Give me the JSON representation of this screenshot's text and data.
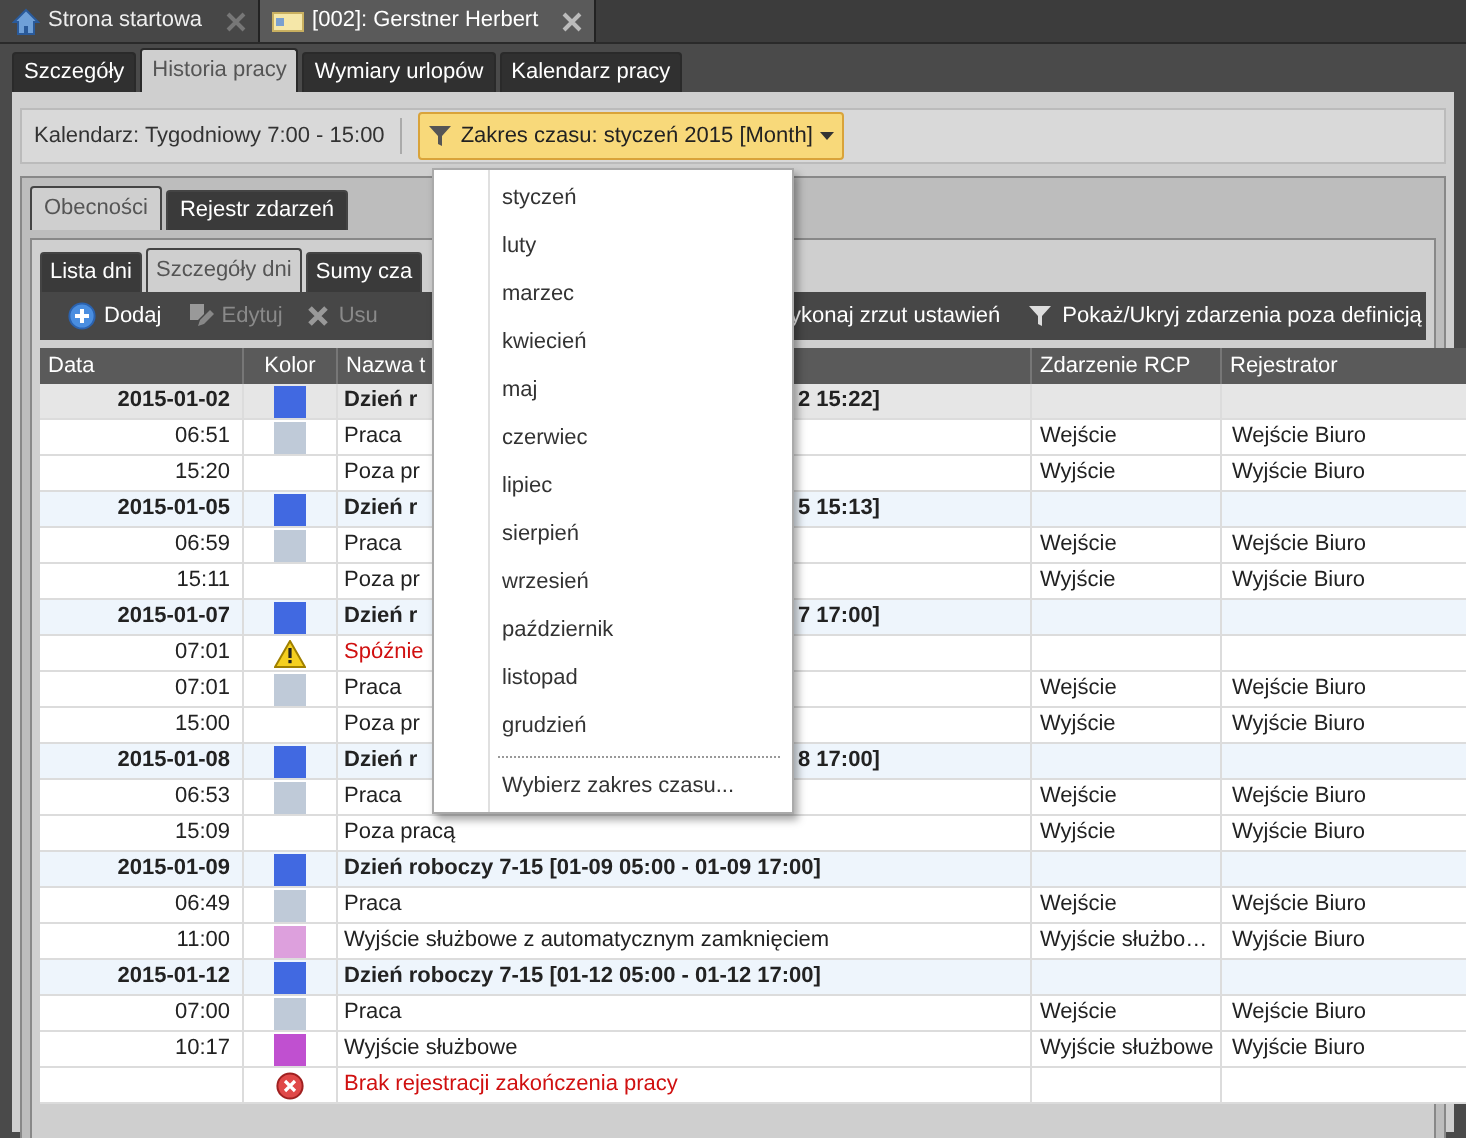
{
  "doc_tabs": [
    {
      "label": "Strona startowa",
      "selected": false
    },
    {
      "label": "[002]: Gerstner Herbert",
      "selected": true
    }
  ],
  "tabs": [
    {
      "label": "Szczegóły",
      "selected": false
    },
    {
      "label": "Historia pracy",
      "selected": true
    },
    {
      "label": "Wymiary urlopów",
      "selected": false
    },
    {
      "label": "Kalendarz pracy",
      "selected": false
    }
  ],
  "calendar_label": "Kalendarz: Tygodniowy 7:00 - 15:00",
  "time_range_button": "Zakres czasu: styczeń 2015 [Month]",
  "inner_tabs": [
    {
      "label": "Obecności",
      "selected": true
    },
    {
      "label": "Rejestr zdarzeń",
      "selected": false
    }
  ],
  "sub_tabs": [
    {
      "label": "Lista dni",
      "selected": false
    },
    {
      "label": "Szczegóły dni",
      "selected": true
    },
    {
      "label": "Sumy cza",
      "selected": false
    }
  ],
  "toolbar": [
    {
      "label": "Dodaj",
      "disabled": false
    },
    {
      "label": "Edytuj",
      "disabled": true
    },
    {
      "label": "Usu",
      "disabled": true
    }
  ],
  "toolbar_right": [
    "ykonaj zrzut ustawień",
    "Pokaż/Ukryj zdarzenia poza definicją"
  ],
  "table": {
    "columns": [
      "Data",
      "Kolor",
      "Nazwa t",
      "Zdarzenie RCP",
      "Rejestrator"
    ],
    "rows": [
      {
        "kind": "day",
        "selected": true,
        "date": "2015-01-02",
        "color": "#4169e1",
        "name": "Dzień r",
        "name_tail": "2 15:22]"
      },
      {
        "kind": "entry",
        "date": "06:51",
        "color": "#bfcad8",
        "name": "Praca",
        "event": "Wejście",
        "registrar": "Wejście Biuro"
      },
      {
        "kind": "entry",
        "date": "15:20",
        "name": "Poza pr",
        "event": "Wyjście",
        "registrar": "Wyjście Biuro"
      },
      {
        "kind": "day",
        "selected": false,
        "date": "2015-01-05",
        "color": "#4169e1",
        "name": "Dzień r",
        "name_tail": "5 15:13]"
      },
      {
        "kind": "entry",
        "date": "06:59",
        "color": "#bfcad8",
        "name": "Praca",
        "event": "Wejście",
        "registrar": "Wejście Biuro"
      },
      {
        "kind": "entry",
        "date": "15:11",
        "name": "Poza pr",
        "event": "Wyjście",
        "registrar": "Wyjście Biuro"
      },
      {
        "kind": "day",
        "selected": false,
        "date": "2015-01-07",
        "color": "#4169e1",
        "name": "Dzień r",
        "name_tail": "7 17:00]"
      },
      {
        "kind": "warning",
        "date": "07:01",
        "name": "Spóźnie"
      },
      {
        "kind": "entry",
        "date": "07:01",
        "color": "#bfcad8",
        "name": "Praca",
        "event": "Wejście",
        "registrar": "Wejście Biuro"
      },
      {
        "kind": "entry",
        "date": "15:00",
        "name": "Poza pr",
        "event": "Wyjście",
        "registrar": "Wyjście Biuro"
      },
      {
        "kind": "day",
        "selected": false,
        "date": "2015-01-08",
        "color": "#4169e1",
        "name": "Dzień r",
        "name_tail": "8 17:00]"
      },
      {
        "kind": "entry",
        "date": "06:53",
        "color": "#bfcad8",
        "name": "Praca",
        "event": "Wejście",
        "registrar": "Wejście Biuro"
      },
      {
        "kind": "entry",
        "date": "15:09",
        "name": "Poza pracą",
        "event": "Wyjście",
        "registrar": "Wyjście Biuro"
      },
      {
        "kind": "day",
        "selected": false,
        "date": "2015-01-09",
        "color": "#4169e1",
        "name": "Dzień roboczy 7-15 [01-09 05:00 - 01-09 17:00]"
      },
      {
        "kind": "entry",
        "date": "06:49",
        "color": "#bfcad8",
        "name": "Praca",
        "event": "Wejście",
        "registrar": "Wejście Biuro"
      },
      {
        "kind": "entry",
        "date": "11:00",
        "color": "#dda0dd",
        "name": "Wyjście służbowe z automatycznym zamknięciem",
        "event": "Wyjście służbo…",
        "registrar": "Wyjście Biuro"
      },
      {
        "kind": "day",
        "selected": false,
        "date": "2015-01-12",
        "color": "#4169e1",
        "name": "Dzień roboczy 7-15 [01-12 05:00 - 01-12 17:00]"
      },
      {
        "kind": "entry",
        "date": "07:00",
        "color": "#bfcad8",
        "name": "Praca",
        "event": "Wejście",
        "registrar": "Wejście Biuro"
      },
      {
        "kind": "entry",
        "date": "10:17",
        "color": "#c050d0",
        "name": "Wyjście służbowe",
        "event": "Wyjście służbowe",
        "registrar": "Wyjście Biuro"
      },
      {
        "kind": "error",
        "name": "Brak rejestracji zakończenia pracy"
      }
    ]
  },
  "dropdown": {
    "items": [
      "styczeń",
      "luty",
      "marzec",
      "kwiecień",
      "maj",
      "czerwiec",
      "lipiec",
      "sierpień",
      "wrzesień",
      "październik",
      "listopad",
      "grudzień"
    ],
    "footer": "Wybierz zakres czasu..."
  }
}
